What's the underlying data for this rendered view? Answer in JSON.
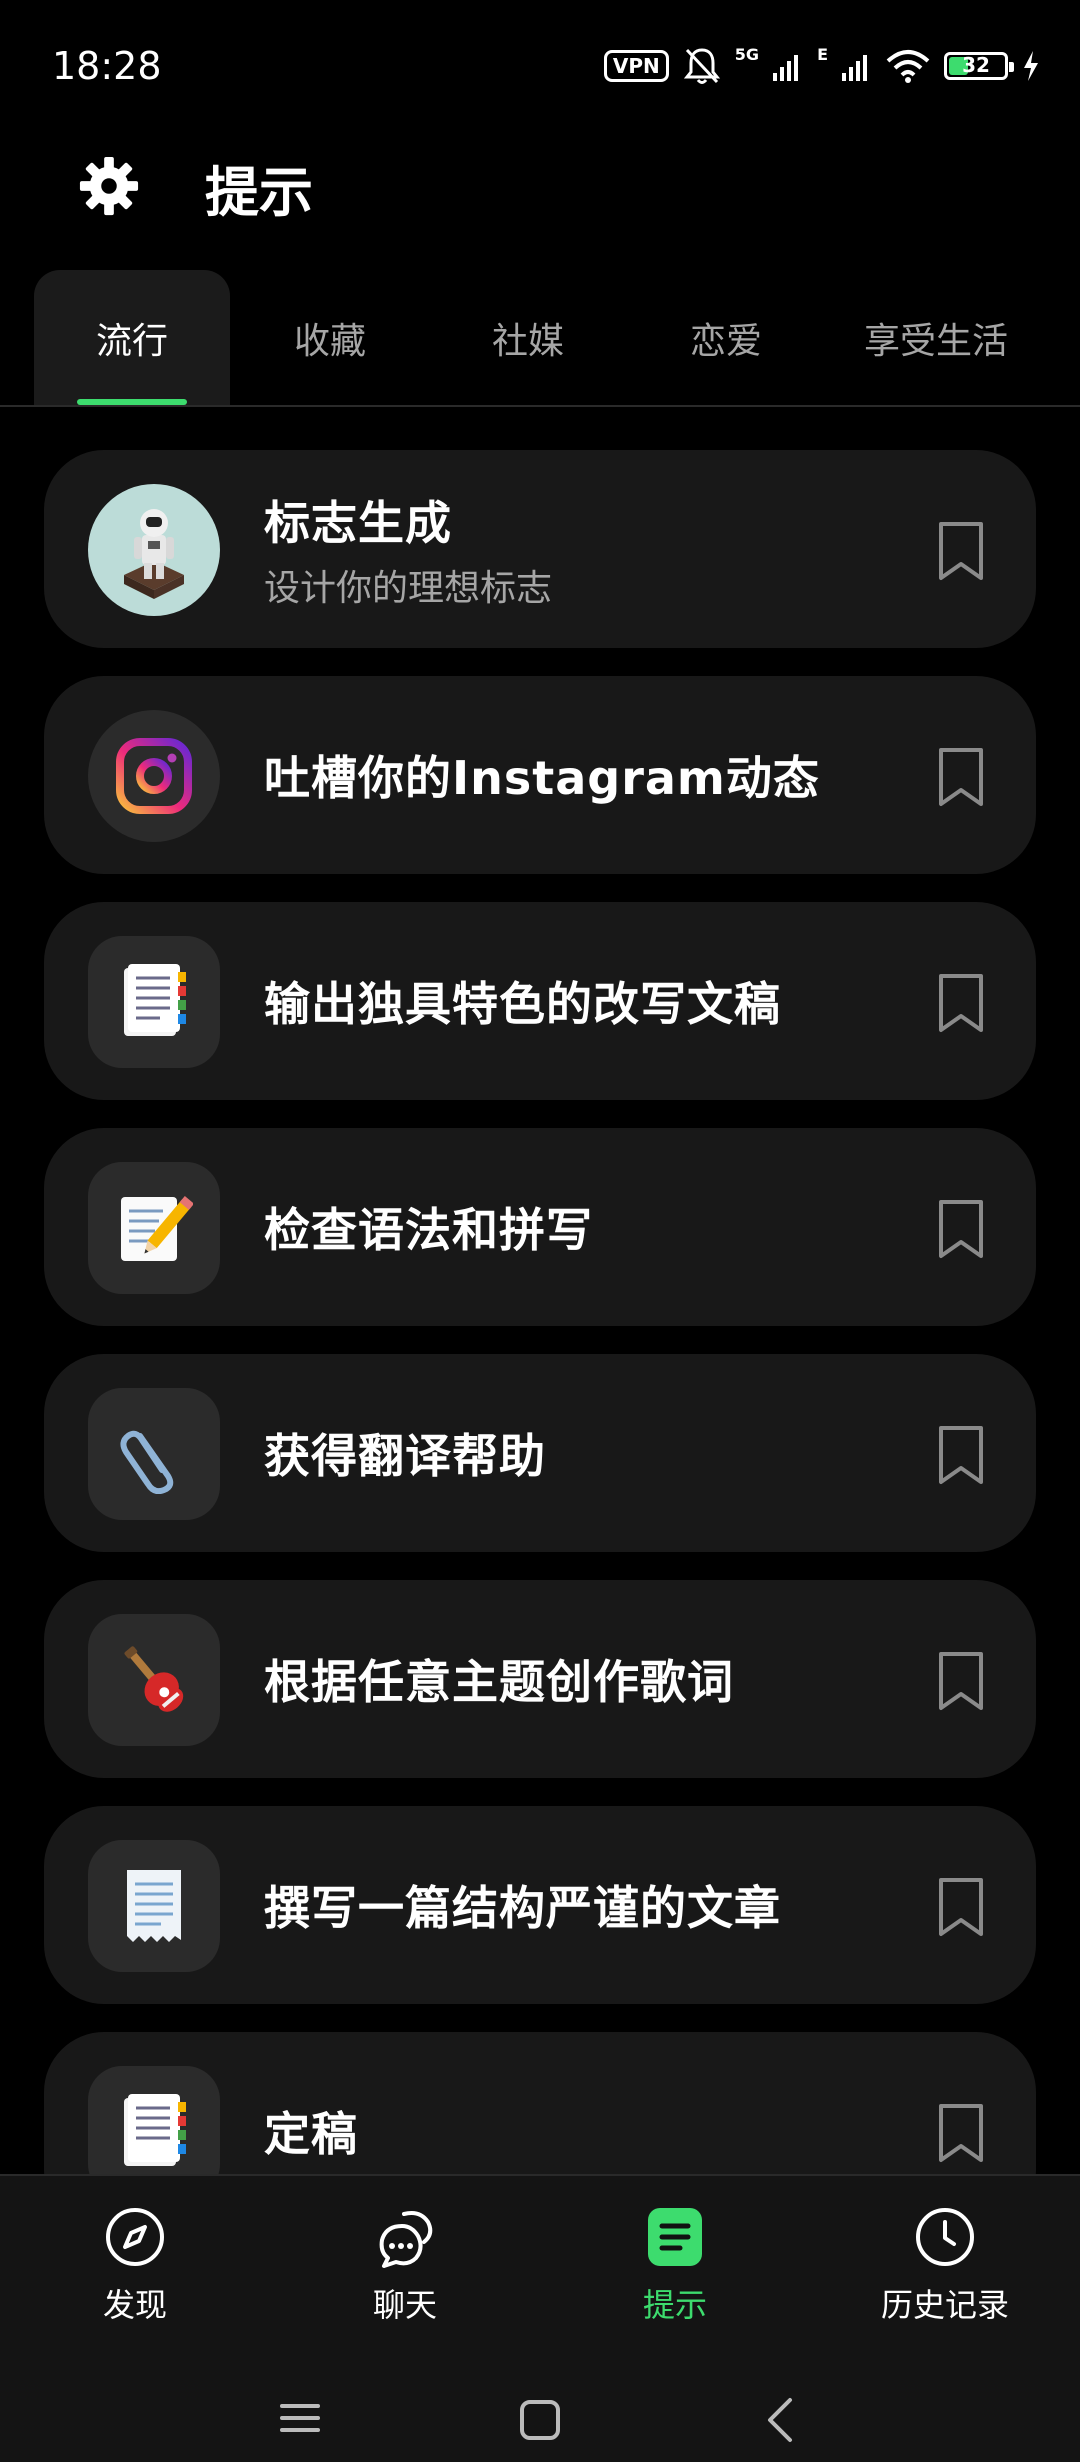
{
  "status": {
    "time": "18:28",
    "vpn": "VPN",
    "network": "5G",
    "network2": "E",
    "battery": "32"
  },
  "header": {
    "title": "提示",
    "settings_icon": "gear-icon"
  },
  "tabs": [
    {
      "label": "流行",
      "active": true
    },
    {
      "label": "收藏",
      "active": false
    },
    {
      "label": "社媒",
      "active": false
    },
    {
      "label": "恋爱",
      "active": false
    },
    {
      "label": "享受生活",
      "active": false
    }
  ],
  "prompts": [
    {
      "title": "标志生成",
      "subtitle": "设计你的理想标志",
      "icon": "astronaut-icon"
    },
    {
      "title": "吐槽你的Instagram动态",
      "subtitle": "",
      "icon": "instagram-icon"
    },
    {
      "title": "输出独具特色的改写文稿",
      "subtitle": "",
      "icon": "notebook-icon"
    },
    {
      "title": "检查语法和拼写",
      "subtitle": "",
      "icon": "memo-pencil-icon"
    },
    {
      "title": "获得翻译帮助",
      "subtitle": "",
      "icon": "paperclip-icon"
    },
    {
      "title": "根据任意主题创作歌词",
      "subtitle": "",
      "icon": "guitar-icon"
    },
    {
      "title": "撰写一篇结构严谨的文章",
      "subtitle": "",
      "icon": "receipt-icon"
    },
    {
      "title": "定稿",
      "subtitle": "",
      "icon": "notebook-icon"
    }
  ],
  "bottom_nav": [
    {
      "label": "发现",
      "icon": "compass-icon",
      "active": false
    },
    {
      "label": "聊天",
      "icon": "chat-bubbles-icon",
      "active": false
    },
    {
      "label": "提示",
      "icon": "prompt-list-icon",
      "active": true
    },
    {
      "label": "历史记录",
      "icon": "clock-icon",
      "active": false
    }
  ],
  "colors": {
    "accent": "#3ddc6e",
    "card": "#181818",
    "background": "#000000"
  }
}
